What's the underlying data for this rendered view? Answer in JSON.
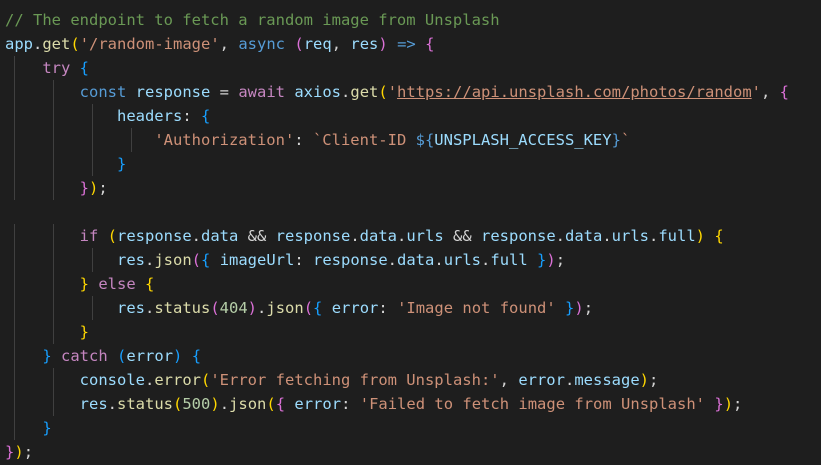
{
  "editor": {
    "lines": [
      [
        {
          "t": "// The endpoint to fetch a random image from Unsplash",
          "c": "comment"
        }
      ],
      [
        {
          "t": "app",
          "c": "var"
        },
        {
          "t": ".",
          "c": "punct"
        },
        {
          "t": "get",
          "c": "func"
        },
        {
          "t": "(",
          "c": "bracket1"
        },
        {
          "t": "'/random-image'",
          "c": "string"
        },
        {
          "t": ", ",
          "c": "punct"
        },
        {
          "t": "async",
          "c": "keyword"
        },
        {
          "t": " ",
          "c": "plain"
        },
        {
          "t": "(",
          "c": "bracket2"
        },
        {
          "t": "req",
          "c": "var"
        },
        {
          "t": ", ",
          "c": "punct"
        },
        {
          "t": "res",
          "c": "var"
        },
        {
          "t": ")",
          "c": "bracket2"
        },
        {
          "t": " ",
          "c": "plain"
        },
        {
          "t": "=>",
          "c": "keyword"
        },
        {
          "t": " ",
          "c": "plain"
        },
        {
          "t": "{",
          "c": "bracket2"
        }
      ],
      [
        {
          "t": "try",
          "c": "control"
        },
        {
          "t": " ",
          "c": "plain"
        },
        {
          "t": "{",
          "c": "bracket3"
        }
      ],
      [
        {
          "t": "const",
          "c": "keyword"
        },
        {
          "t": " ",
          "c": "plain"
        },
        {
          "t": "response",
          "c": "var"
        },
        {
          "t": " = ",
          "c": "plain"
        },
        {
          "t": "await",
          "c": "control"
        },
        {
          "t": " ",
          "c": "plain"
        },
        {
          "t": "axios",
          "c": "var"
        },
        {
          "t": ".",
          "c": "punct"
        },
        {
          "t": "get",
          "c": "func"
        },
        {
          "t": "(",
          "c": "bracket1"
        },
        {
          "t": "'",
          "c": "string"
        },
        {
          "t": "https://api.unsplash.com/photos/random",
          "c": "string",
          "u": true
        },
        {
          "t": "'",
          "c": "string"
        },
        {
          "t": ", ",
          "c": "punct"
        },
        {
          "t": "{",
          "c": "bracket2"
        }
      ],
      [
        {
          "t": "headers",
          "c": "var"
        },
        {
          "t": ": ",
          "c": "plain"
        },
        {
          "t": "{",
          "c": "bracket3"
        }
      ],
      [
        {
          "t": "'Authorization'",
          "c": "string"
        },
        {
          "t": ": ",
          "c": "plain"
        },
        {
          "t": "`Client-ID ",
          "c": "string"
        },
        {
          "t": "${",
          "c": "keyword"
        },
        {
          "t": "UNSPLASH_ACCESS_KEY",
          "c": "var"
        },
        {
          "t": "}",
          "c": "keyword"
        },
        {
          "t": "`",
          "c": "string"
        }
      ],
      [
        {
          "t": "}",
          "c": "bracket3"
        }
      ],
      [
        {
          "t": "}",
          "c": "bracket2"
        },
        {
          "t": ")",
          "c": "bracket1"
        },
        {
          "t": ";",
          "c": "punct"
        }
      ],
      [],
      [
        {
          "t": "if",
          "c": "control"
        },
        {
          "t": " ",
          "c": "plain"
        },
        {
          "t": "(",
          "c": "bracket1"
        },
        {
          "t": "response",
          "c": "var"
        },
        {
          "t": ".",
          "c": "punct"
        },
        {
          "t": "data",
          "c": "var"
        },
        {
          "t": " && ",
          "c": "plain"
        },
        {
          "t": "response",
          "c": "var"
        },
        {
          "t": ".",
          "c": "punct"
        },
        {
          "t": "data",
          "c": "var"
        },
        {
          "t": ".",
          "c": "punct"
        },
        {
          "t": "urls",
          "c": "var"
        },
        {
          "t": " && ",
          "c": "plain"
        },
        {
          "t": "response",
          "c": "var"
        },
        {
          "t": ".",
          "c": "punct"
        },
        {
          "t": "data",
          "c": "var"
        },
        {
          "t": ".",
          "c": "punct"
        },
        {
          "t": "urls",
          "c": "var"
        },
        {
          "t": ".",
          "c": "punct"
        },
        {
          "t": "full",
          "c": "var"
        },
        {
          "t": ")",
          "c": "bracket1"
        },
        {
          "t": " ",
          "c": "plain"
        },
        {
          "t": "{",
          "c": "bracket1"
        }
      ],
      [
        {
          "t": "res",
          "c": "var"
        },
        {
          "t": ".",
          "c": "punct"
        },
        {
          "t": "json",
          "c": "func"
        },
        {
          "t": "(",
          "c": "bracket2"
        },
        {
          "t": "{",
          "c": "bracket3"
        },
        {
          "t": " ",
          "c": "plain"
        },
        {
          "t": "imageUrl",
          "c": "var"
        },
        {
          "t": ": ",
          "c": "plain"
        },
        {
          "t": "response",
          "c": "var"
        },
        {
          "t": ".",
          "c": "punct"
        },
        {
          "t": "data",
          "c": "var"
        },
        {
          "t": ".",
          "c": "punct"
        },
        {
          "t": "urls",
          "c": "var"
        },
        {
          "t": ".",
          "c": "punct"
        },
        {
          "t": "full",
          "c": "var"
        },
        {
          "t": " ",
          "c": "plain"
        },
        {
          "t": "}",
          "c": "bracket3"
        },
        {
          "t": ")",
          "c": "bracket2"
        },
        {
          "t": ";",
          "c": "punct"
        }
      ],
      [
        {
          "t": "}",
          "c": "bracket1"
        },
        {
          "t": " ",
          "c": "plain"
        },
        {
          "t": "else",
          "c": "control"
        },
        {
          "t": " ",
          "c": "plain"
        },
        {
          "t": "{",
          "c": "bracket1"
        }
      ],
      [
        {
          "t": "res",
          "c": "var"
        },
        {
          "t": ".",
          "c": "punct"
        },
        {
          "t": "status",
          "c": "func"
        },
        {
          "t": "(",
          "c": "bracket2"
        },
        {
          "t": "404",
          "c": "number"
        },
        {
          "t": ")",
          "c": "bracket2"
        },
        {
          "t": ".",
          "c": "punct"
        },
        {
          "t": "json",
          "c": "func"
        },
        {
          "t": "(",
          "c": "bracket2"
        },
        {
          "t": "{",
          "c": "bracket3"
        },
        {
          "t": " ",
          "c": "plain"
        },
        {
          "t": "error",
          "c": "var"
        },
        {
          "t": ": ",
          "c": "plain"
        },
        {
          "t": "'Image not found'",
          "c": "string"
        },
        {
          "t": " ",
          "c": "plain"
        },
        {
          "t": "}",
          "c": "bracket3"
        },
        {
          "t": ")",
          "c": "bracket2"
        },
        {
          "t": ";",
          "c": "punct"
        }
      ],
      [
        {
          "t": "}",
          "c": "bracket1"
        }
      ],
      [
        {
          "t": "}",
          "c": "bracket3"
        },
        {
          "t": " ",
          "c": "plain"
        },
        {
          "t": "catch",
          "c": "control"
        },
        {
          "t": " ",
          "c": "plain"
        },
        {
          "t": "(",
          "c": "bracket3"
        },
        {
          "t": "error",
          "c": "var"
        },
        {
          "t": ")",
          "c": "bracket3"
        },
        {
          "t": " ",
          "c": "plain"
        },
        {
          "t": "{",
          "c": "bracket3"
        }
      ],
      [
        {
          "t": "console",
          "c": "var"
        },
        {
          "t": ".",
          "c": "punct"
        },
        {
          "t": "error",
          "c": "func"
        },
        {
          "t": "(",
          "c": "bracket1"
        },
        {
          "t": "'Error fetching from Unsplash:'",
          "c": "string"
        },
        {
          "t": ", ",
          "c": "punct"
        },
        {
          "t": "error",
          "c": "var"
        },
        {
          "t": ".",
          "c": "punct"
        },
        {
          "t": "message",
          "c": "var"
        },
        {
          "t": ")",
          "c": "bracket1"
        },
        {
          "t": ";",
          "c": "punct"
        }
      ],
      [
        {
          "t": "res",
          "c": "var"
        },
        {
          "t": ".",
          "c": "punct"
        },
        {
          "t": "status",
          "c": "func"
        },
        {
          "t": "(",
          "c": "bracket1"
        },
        {
          "t": "500",
          "c": "number"
        },
        {
          "t": ")",
          "c": "bracket1"
        },
        {
          "t": ".",
          "c": "punct"
        },
        {
          "t": "json",
          "c": "func"
        },
        {
          "t": "(",
          "c": "bracket1"
        },
        {
          "t": "{",
          "c": "bracket2"
        },
        {
          "t": " ",
          "c": "plain"
        },
        {
          "t": "error",
          "c": "var"
        },
        {
          "t": ": ",
          "c": "plain"
        },
        {
          "t": "'Failed to fetch image from Unsplash'",
          "c": "string"
        },
        {
          "t": " ",
          "c": "plain"
        },
        {
          "t": "}",
          "c": "bracket2"
        },
        {
          "t": ")",
          "c": "bracket1"
        },
        {
          "t": ";",
          "c": "punct"
        }
      ],
      [
        {
          "t": "}",
          "c": "bracket3"
        }
      ],
      [
        {
          "t": "}",
          "c": "bracket2"
        },
        {
          "t": ")",
          "c": "bracket1"
        },
        {
          "t": ";",
          "c": "punct"
        }
      ]
    ],
    "indent": [
      0,
      0,
      1,
      2,
      3,
      4,
      3,
      2,
      0,
      2,
      3,
      2,
      3,
      2,
      1,
      2,
      2,
      1,
      0
    ],
    "colors": {
      "background": "#1e1e1e",
      "comment": "#6a9955",
      "variable": "#9cdcfe",
      "function": "#dcdcaa",
      "keyword": "#569cd6",
      "control": "#c586c0",
      "string": "#ce9178",
      "number": "#b5cea8",
      "bracket_gold": "#ffd700",
      "bracket_orchid": "#da70d6",
      "bracket_blue": "#179fff"
    }
  }
}
